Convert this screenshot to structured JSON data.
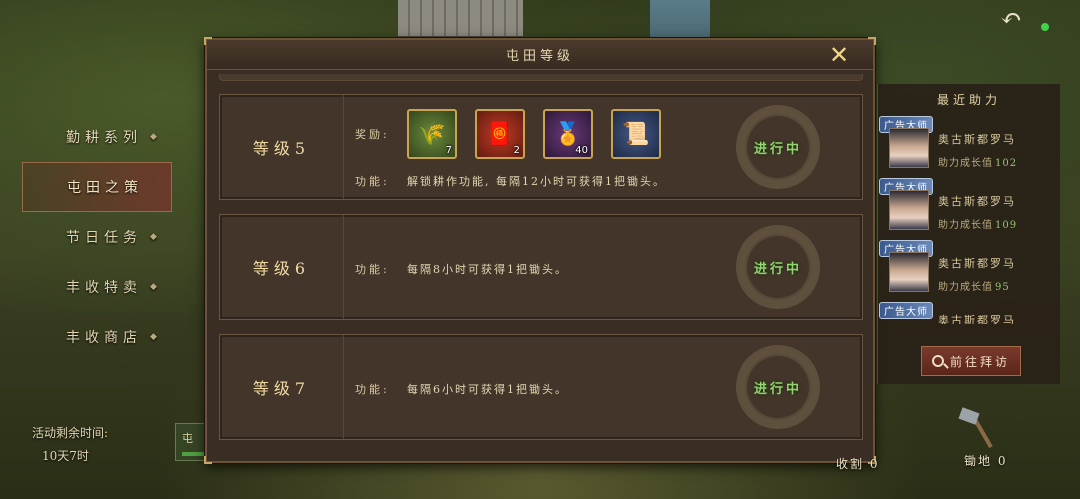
{
  "header": {
    "title": "屯田等级",
    "close_icon": "close-icon"
  },
  "left_menu": {
    "items": [
      {
        "label": "勤耕系列",
        "active": false
      },
      {
        "label": "屯田之策",
        "active": true
      },
      {
        "label": "节日任务",
        "active": false
      },
      {
        "label": "丰收特卖",
        "active": false
      },
      {
        "label": "丰收商店",
        "active": false
      }
    ]
  },
  "countdown": {
    "label": "活动剩余时间:",
    "value": "10天7时"
  },
  "bottom_tab": {
    "label": "屯"
  },
  "levels": [
    {
      "title": "等级5",
      "reward_label": "奖励:",
      "rewards": [
        {
          "icon": "wheat-icon",
          "qty": "7",
          "color": "#6c8a3c"
        },
        {
          "icon": "red-envelope-icon",
          "qty": "2",
          "color": "#c23a24"
        },
        {
          "icon": "gold-seal-icon",
          "qty": "40",
          "color": "#6a3a7a"
        },
        {
          "icon": "scroll-icon",
          "qty": "",
          "color": "#455a86"
        }
      ],
      "func_label": "功能:",
      "func_text": "解锁耕作功能, 每隔12小时可获得1把锄头。",
      "status": "进行中"
    },
    {
      "title": "等级6",
      "func_label": "功能:",
      "func_text": "每隔8小时可获得1把锄头。",
      "status": "进行中"
    },
    {
      "title": "等级7",
      "func_label": "功能:",
      "func_text": "每隔6小时可获得1把锄头。",
      "status": "进行中"
    }
  ],
  "right_panel": {
    "title": "最近助力",
    "helpers": [
      {
        "badge": "广告大师",
        "name": "奥古斯都罗马",
        "stat_label": "助力成长值",
        "stat_value": "102"
      },
      {
        "badge": "广告大师",
        "name": "奥古斯都罗马",
        "stat_label": "助力成长值",
        "stat_value": "109"
      },
      {
        "badge": "广告大师",
        "name": "奥古斯都罗马",
        "stat_label": "助力成长值",
        "stat_value": "95"
      },
      {
        "badge": "广告大师",
        "name": "奥古斯都罗马",
        "stat_label": "",
        "stat_value": ""
      }
    ],
    "visit_button": "前往拜访"
  },
  "hoe": {
    "label": "锄地",
    "count": "0"
  },
  "harvest": {
    "label": "收割",
    "count": "0"
  },
  "colors": {
    "status_green": "#8fd66c",
    "gold_border": "#c9a44f",
    "panel_bg": "#3a2d24"
  }
}
